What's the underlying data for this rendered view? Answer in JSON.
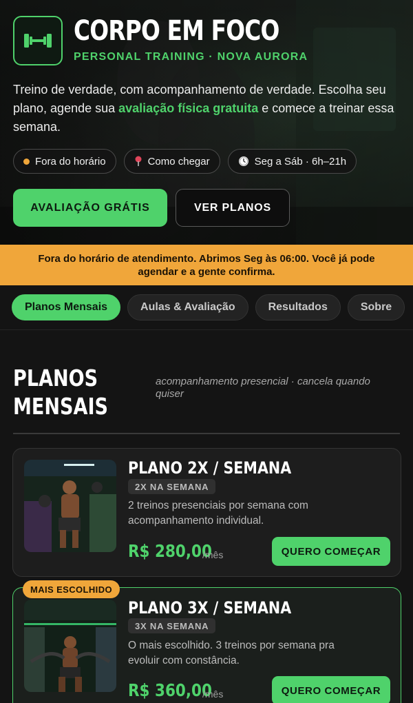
{
  "brand": {
    "title": "CORPO EM FOCO",
    "subtitle": "PERSONAL TRAINING · NOVA AURORA",
    "logo_icon": "dumbbell-icon",
    "accent_color": "#4fd26b",
    "warning_color": "#f0a63a"
  },
  "hero": {
    "text_before": "Treino de verdade, com acompanhamento de verdade. Escolha seu plano, agende sua ",
    "text_highlight": "avaliação física gratuita",
    "text_after": " e comece a treinar essa semana.",
    "pills": {
      "status": "Fora do horário",
      "directions": "Como chegar",
      "directions_icon": "pin-icon",
      "hours": "Seg a Sáb · 6h–21h",
      "hours_icon": "clock-icon"
    },
    "primary_button": "AVALIAÇÃO GRÁTIS",
    "secondary_button": "VER PLANOS"
  },
  "banner": {
    "text": "Fora do horário de atendimento. Abrimos Seg às 06:00. Você já pode agendar e a gente confirma."
  },
  "tabs": {
    "plans": "Planos Mensais",
    "classes": "Aulas & Avaliação",
    "results": "Resultados",
    "about": "Sobre"
  },
  "section": {
    "title": "PLANOS MENSAIS",
    "subtitle": "acompanhamento presencial · cancela quando quiser"
  },
  "plans": [
    {
      "title": "PLANO 2X / SEMANA",
      "frequency": "2X NA SEMANA",
      "description": "2 treinos presenciais por semana com acompanhamento individual.",
      "price": "R$ 280,00",
      "period": "/mês",
      "button": "QUERO COMEÇAR"
    },
    {
      "badge": "MAIS ESCOLHIDO",
      "title": "PLANO 3X / SEMANA",
      "frequency": "3X NA SEMANA",
      "description": "O mais escolhido. 3 treinos por semana pra evoluir com constância.",
      "price": "R$ 360,00",
      "period": "/mês",
      "button": "QUERO COMEÇAR"
    }
  ]
}
